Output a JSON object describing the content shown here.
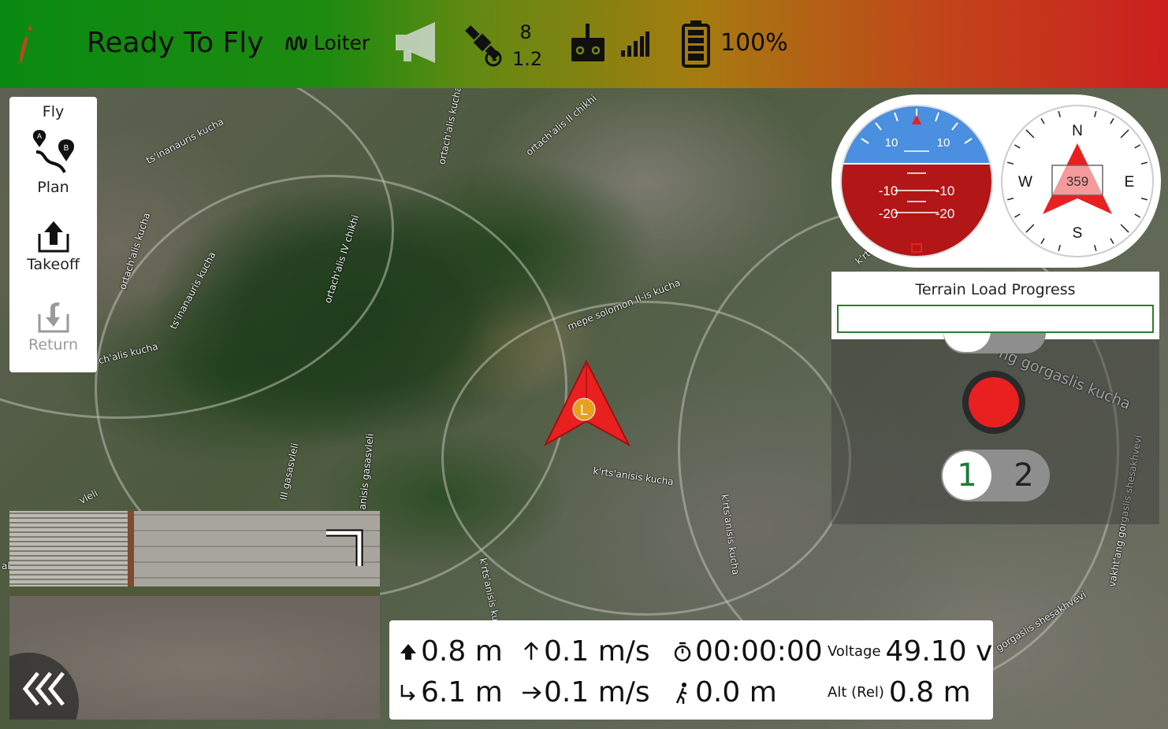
{
  "header": {
    "status": "Ready To Fly",
    "flight_mode": "Loiter",
    "satellites": "8",
    "hdop": "1.2",
    "battery": "100%"
  },
  "toolbar": {
    "fly": "Fly",
    "plan": "Plan",
    "takeoff": "Takeoff",
    "return": "Return"
  },
  "map": {
    "streets": [
      "ts'inanauris kucha",
      "ortach'alis kucha",
      "ortach'alis II chikhi",
      "ortach'alis kucha",
      "ts'inanauris kucha",
      "ortach'alis IV chikhi",
      "mepe solomon II-is kucha",
      "ch'alis kucha",
      "k'rts'anisis kucha",
      "k'rts'anisis kucha",
      "k'rts'anisis ku",
      "ng gorgaslis kucha",
      "gorgaslis shesakhvevi",
      "vakht'ang gorgaslis shesakhvevi",
      "III gasasvleli",
      "anisis gasasvleli",
      "vleli",
      "ak",
      "k'rts"
    ],
    "vehicle_marker": "L"
  },
  "instruments": {
    "attitude_labels": [
      "10",
      "10",
      "-10",
      "-10",
      "-20",
      "-20"
    ],
    "compass": {
      "heading": "359",
      "north": "N",
      "south": "S",
      "east": "E",
      "west": "W"
    }
  },
  "terrain": {
    "title": "Terrain Load Progress",
    "progress": 0
  },
  "camera": {
    "option_1": "1",
    "option_2": "2"
  },
  "telemetry": {
    "altitude": "0.8 m",
    "vertical_speed": "0.1 m/s",
    "flight_time": "00:00:00",
    "voltage_label": "Voltage",
    "voltage": "49.10 v",
    "distance": "6.1 m",
    "horizontal_speed": "0.1 m/s",
    "home_distance": "0.0 m",
    "alt_rel_label": "Alt (Rel)",
    "alt_rel": "0.8 m"
  },
  "colors": {
    "vehicle": "#e82020",
    "record": "#e82020",
    "terrain_bar": "#2d7d2d",
    "sky": "#4a8fe0",
    "ground": "#b31616"
  }
}
